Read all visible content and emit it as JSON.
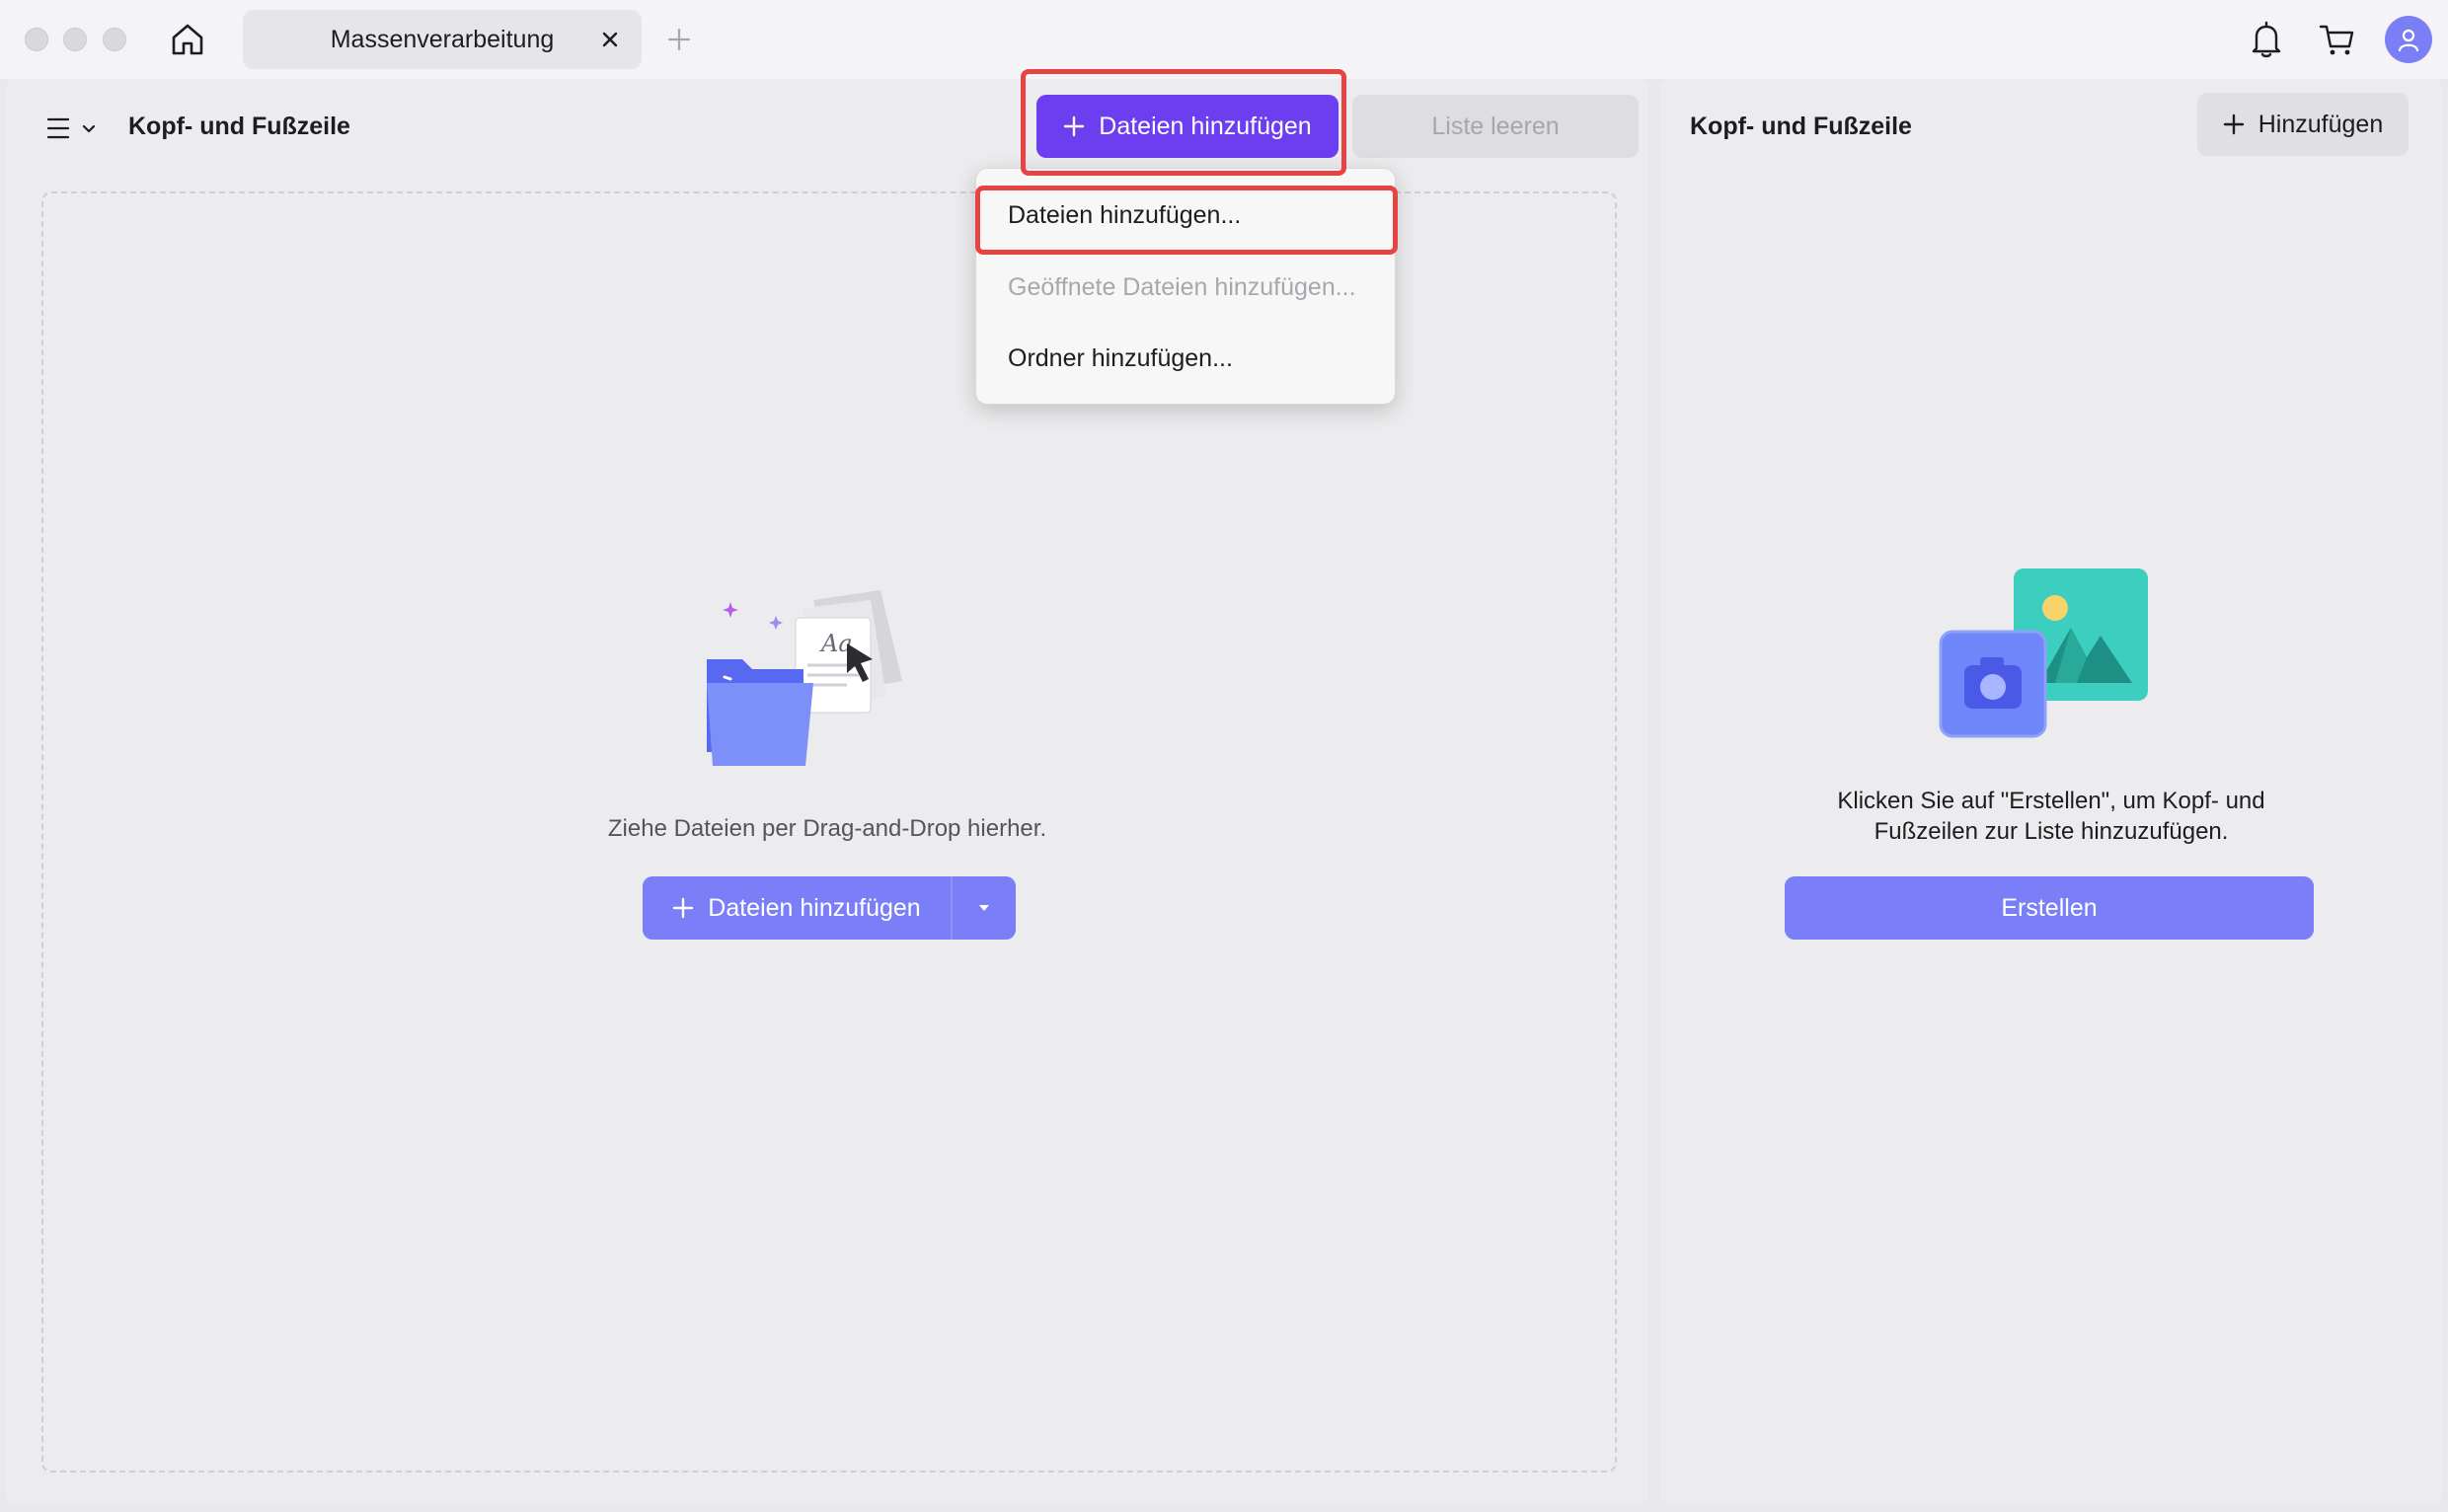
{
  "window": {
    "tab_title": "Massenverarbeitung"
  },
  "left_panel": {
    "title": "Kopf- und Fußzeile",
    "add_files_button": "Dateien hinzufügen",
    "clear_list_button": "Liste leeren",
    "drop_hint": "Ziehe Dateien per Drag-and-Drop hierher.",
    "split_add_button": "Dateien hinzufügen"
  },
  "dropdown": {
    "items": [
      {
        "label": "Dateien hinzufügen...",
        "enabled": true
      },
      {
        "label": "Geöffnete Dateien hinzufügen...",
        "enabled": false
      },
      {
        "label": "Ordner hinzufügen...",
        "enabled": true
      }
    ]
  },
  "right_panel": {
    "title": "Kopf- und Fußzeile",
    "add_button": "Hinzufügen",
    "hint_line1": "Klicken Sie auf \"Erstellen\", um Kopf- und",
    "hint_line2": "Fußzeilen zur Liste hinzuzufügen.",
    "create_button": "Erstellen"
  },
  "colors": {
    "accent_purple": "#6d3df0",
    "button_blue": "#7a7ff7",
    "highlight_red": "#e84343"
  },
  "icons": [
    "home-icon",
    "close-icon",
    "plus-icon",
    "bell-icon",
    "cart-icon",
    "user-icon",
    "menu-icon",
    "chevron-down-icon",
    "caret-down-icon",
    "folder-illustration",
    "image-illustration"
  ]
}
